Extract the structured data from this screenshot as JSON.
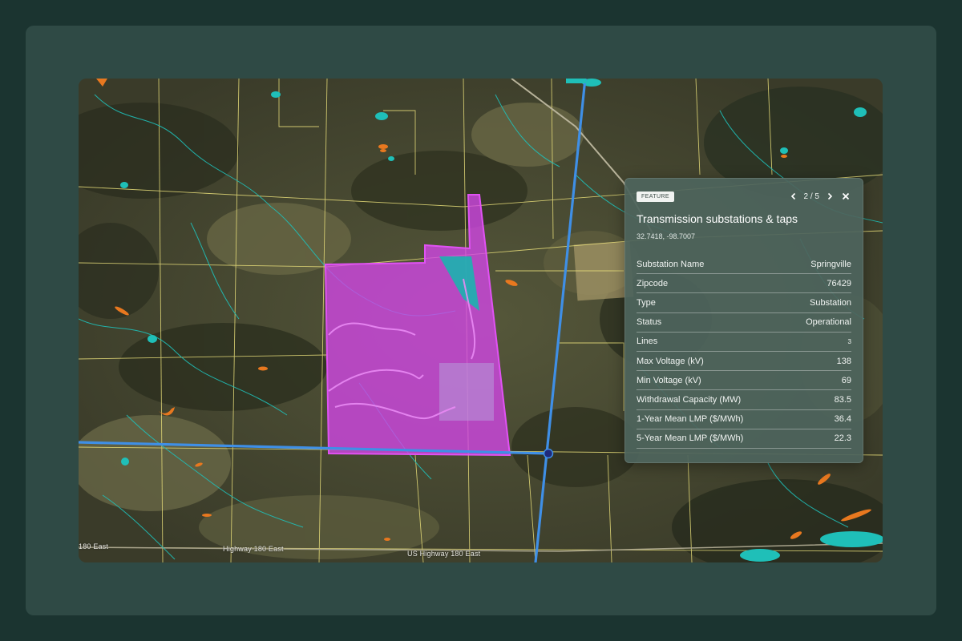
{
  "map": {
    "road_labels": [
      "180 East",
      "Highway 180 East",
      "US Highway 180 East"
    ],
    "colors": {
      "parcel_highlight": "#d447e8",
      "transmission_line": "#3f8fe6",
      "water": "#1fbfb8",
      "wetlands": "#e8781f",
      "parcel_lines": "#e8de7a"
    }
  },
  "panel": {
    "badge": "FEATURE",
    "pager": "2 / 5",
    "title": "Transmission substations & taps",
    "coords": "32.7418, -98.7007",
    "rows": [
      {
        "label": "Substation Name",
        "value": "Springville"
      },
      {
        "label": "Zipcode",
        "value": "76429"
      },
      {
        "label": "Type",
        "value": "Substation"
      },
      {
        "label": "Status",
        "value": "Operational"
      },
      {
        "label": "Lines",
        "value": "3"
      },
      {
        "label": "Max Voltage (kV)",
        "value": "138"
      },
      {
        "label": "Min Voltage (kV)",
        "value": "69"
      },
      {
        "label": "Withdrawal Capacity (MW)",
        "value": "83.5"
      },
      {
        "label": "1-Year Mean LMP ($/MWh)",
        "value": "36.4"
      },
      {
        "label": "5-Year Mean LMP ($/MWh)",
        "value": "22.3"
      }
    ],
    "icons": {
      "prev": "chevron-left-icon",
      "next": "chevron-right-icon",
      "close": "close-icon"
    }
  }
}
